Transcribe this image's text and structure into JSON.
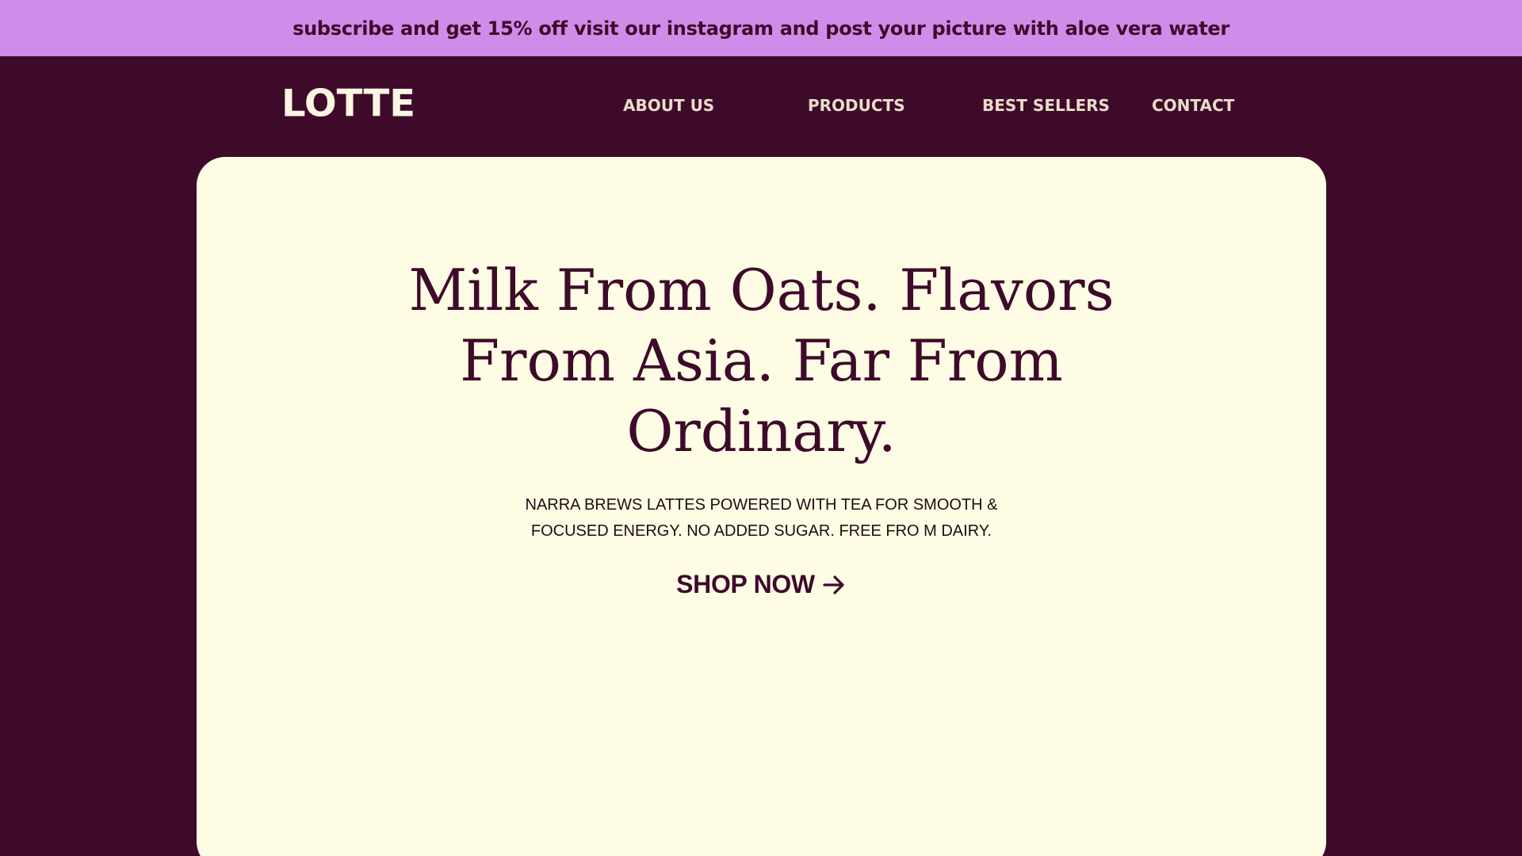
{
  "promo": {
    "text": "subscribe and get 15% off visit our instagram and post your picture with aloe vera water"
  },
  "nav": {
    "logo": "LOTTE",
    "links": [
      {
        "label": "ABOUT US"
      },
      {
        "label": "PRODUCTS"
      },
      {
        "label": "BEST SELLERS"
      },
      {
        "label": "CONTACT"
      }
    ]
  },
  "hero": {
    "title": "Milk From Oats. Flavors From Asia. Far From Ordinary.",
    "subtitle": "NARRA BREWS LATTES POWERED WITH TEA FOR SMOOTH & FOCUSED ENERGY. NO ADDED SUGAR. FREE FRO M DAIRY.",
    "cta_label": "SHOP NOW",
    "cta_icon": "arrow-right-icon"
  },
  "colors": {
    "background": "#3e0a2a",
    "promo_bar": "#cf8ce9",
    "card": "#fefce4",
    "accent_text": "#3e0a2a",
    "nav_text": "#e9dcc9"
  }
}
